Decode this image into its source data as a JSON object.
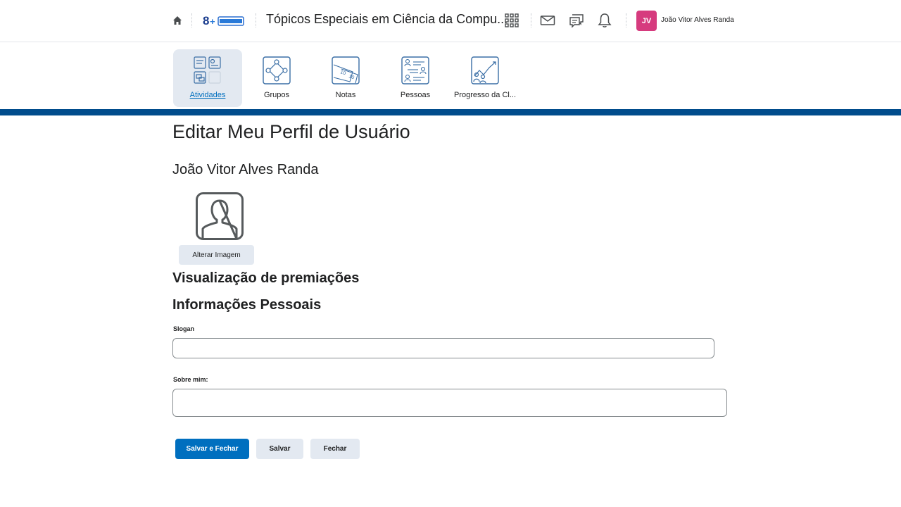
{
  "header": {
    "course_title": "Tópicos Especiais em Ciência da Compu...",
    "user_initials": "JV",
    "user_name": "João Vitor Alves Randa",
    "avatar_color": "#d63b7e",
    "icons": [
      "home-icon",
      "logo",
      "apps-grid-icon",
      "mail-icon",
      "chat-icon",
      "bell-icon"
    ]
  },
  "nav": {
    "items": [
      {
        "label": "Atividades",
        "icon": "activities-icon",
        "active": true
      },
      {
        "label": "Grupos",
        "icon": "groups-icon",
        "active": false
      },
      {
        "label": "Notas",
        "icon": "grades-icon",
        "active": false
      },
      {
        "label": "Pessoas",
        "icon": "people-icon",
        "active": false
      },
      {
        "label": "Progresso da Cl...",
        "icon": "progress-icon",
        "active": false
      }
    ],
    "band_color": "#004c8c"
  },
  "main": {
    "title": "Editar Meu Perfil de Usuário",
    "profile_name": "João Vitor Alves Randa",
    "change_image_label": "Alterar Imagem",
    "awards_heading": "Visualização de premiações",
    "personal_info_heading": "Informações Pessoais",
    "slogan_label": "Slogan",
    "slogan_value": "",
    "about_label": "Sobre mim:",
    "about_value": ""
  },
  "actions": {
    "save_close_label": "Salvar e Fechar",
    "save_label": "Salvar",
    "close_label": "Fechar",
    "primary_color": "#006fbf"
  }
}
